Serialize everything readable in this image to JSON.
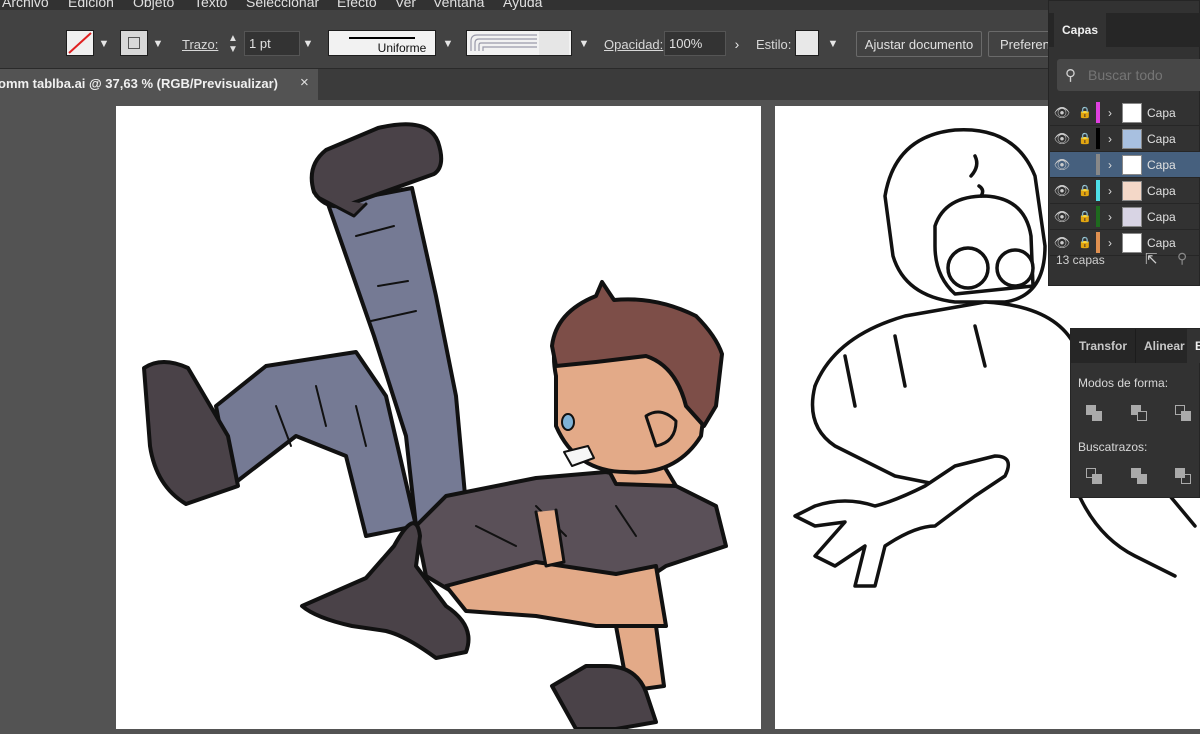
{
  "menu": {
    "items": [
      "Archivo",
      "Edición",
      "Objeto",
      "Texto",
      "Seleccionar",
      "Efecto",
      "Ver",
      "Ventana",
      "Ayuda"
    ]
  },
  "control_bar": {
    "stroke_label": "Trazo:",
    "stroke_value": "1 pt",
    "profile_value": "Uniforme",
    "opacity_label": "Opacidad:",
    "opacity_value": "100%",
    "style_label": "Estilo:",
    "adjust_document_label": "Ajustar documento",
    "preferences_label": "Preferenc"
  },
  "document_tab": {
    "title": "omm tablba.ai @ 37,63 % (RGB/Previsualizar)",
    "close": "×"
  },
  "layers_panel": {
    "tab_label": "Capas",
    "search_placeholder": "Buscar todo",
    "layers": [
      {
        "name": "Capa",
        "color": "#e040e0",
        "selected": false,
        "locked": true
      },
      {
        "name": "Capa",
        "color": "#000000",
        "selected": false,
        "locked": true
      },
      {
        "name": "Capa",
        "color": "#888888",
        "selected": true,
        "locked": false
      },
      {
        "name": "Capa",
        "color": "#4ee0e8",
        "selected": false,
        "locked": true
      },
      {
        "name": "Capa",
        "color": "#1e6a1e",
        "selected": false,
        "locked": true
      },
      {
        "name": "Capa",
        "color": "#e09050",
        "selected": false,
        "locked": true
      }
    ],
    "count_label": "13 capas"
  },
  "pathfinder_panel": {
    "tabs": [
      "Transfor",
      "Alinear",
      "B"
    ],
    "shape_modes_label": "Modos de forma:",
    "pathfinders_label": "Buscatrazos:"
  },
  "colors": {
    "ui_dark": "#323232",
    "ui_mid": "#424242",
    "selection": "#46607e",
    "jeans": "#757a94",
    "shirt": "#5a5058",
    "skin": "#e3aa88",
    "hair": "#7d4e48",
    "boots": "#4a4248"
  }
}
